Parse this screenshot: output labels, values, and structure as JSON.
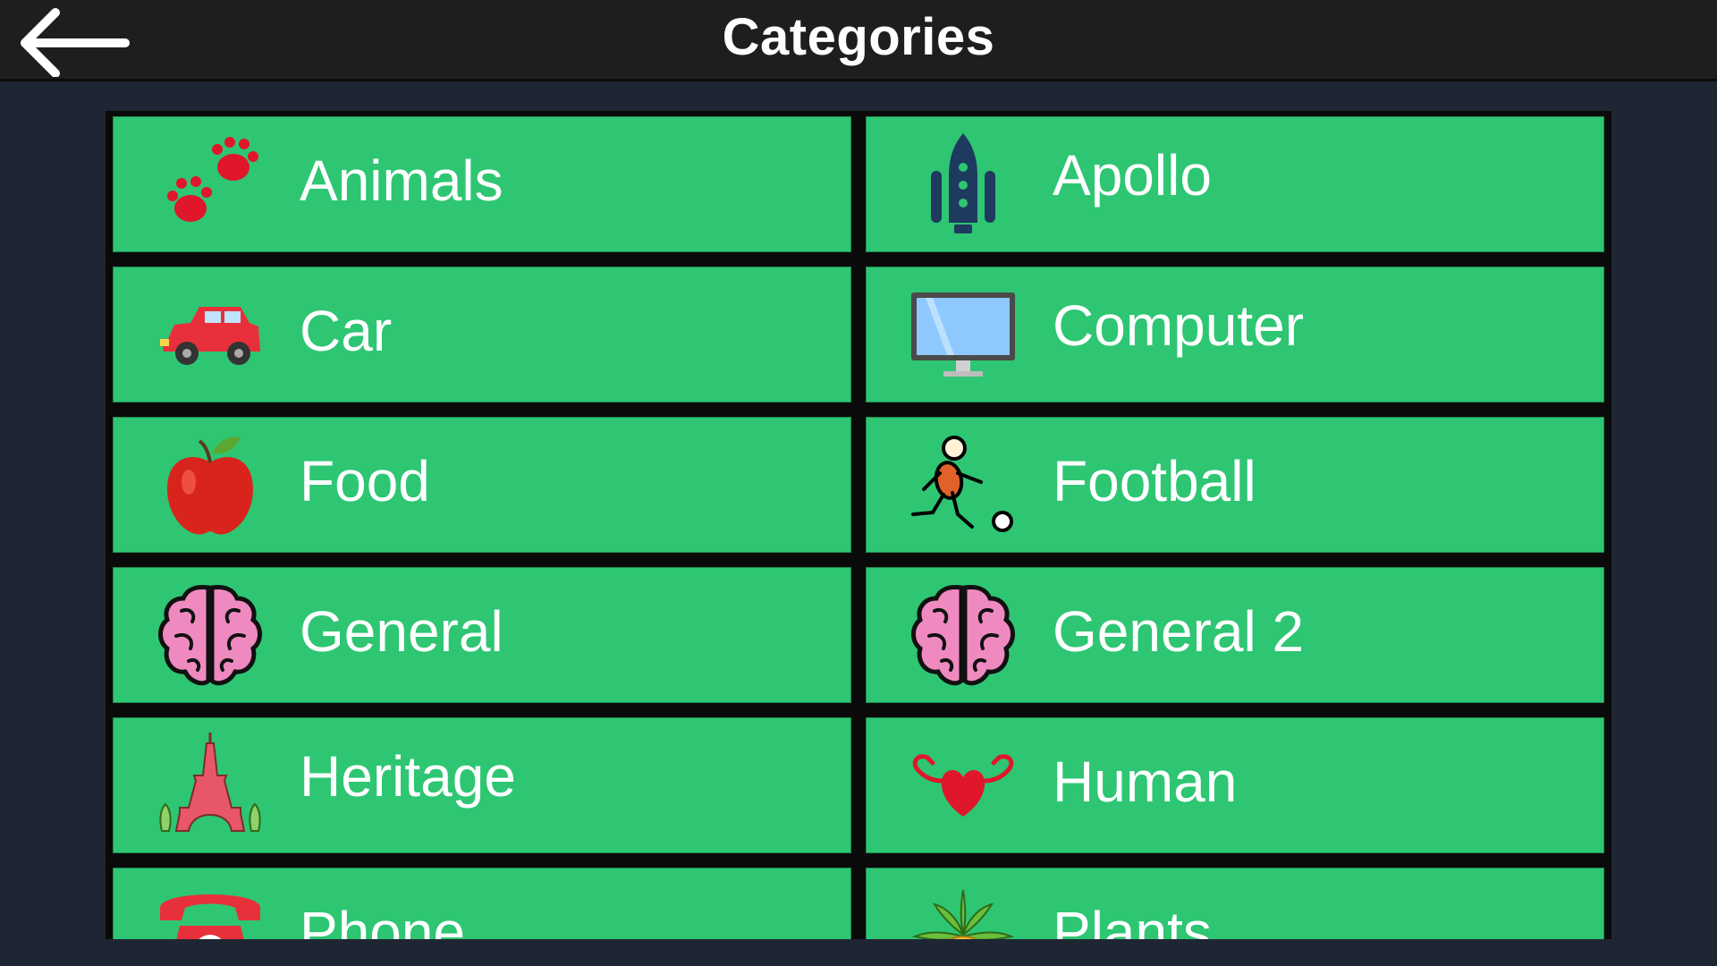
{
  "header": {
    "title": "Categories"
  },
  "categories": [
    {
      "label": "Animals",
      "icon": "paw-prints-icon"
    },
    {
      "label": "Apollo",
      "icon": "rocket-icon"
    },
    {
      "label": "Car",
      "icon": "car-icon"
    },
    {
      "label": "Computer",
      "icon": "monitor-icon"
    },
    {
      "label": "Food",
      "icon": "apple-icon"
    },
    {
      "label": "Football",
      "icon": "football-player-icon"
    },
    {
      "label": "General",
      "icon": "brain-icon"
    },
    {
      "label": "General 2",
      "icon": "brain-icon"
    },
    {
      "label": "Heritage",
      "icon": "eiffel-tower-icon"
    },
    {
      "label": "Human",
      "icon": "heart-muscles-icon"
    },
    {
      "label": "Phone",
      "icon": "telephone-icon"
    },
    {
      "label": "Plants",
      "icon": "plant-icon"
    }
  ],
  "colors": {
    "tile": "#2ec673",
    "background": "#1f2633",
    "header": "#1e1e1e"
  }
}
